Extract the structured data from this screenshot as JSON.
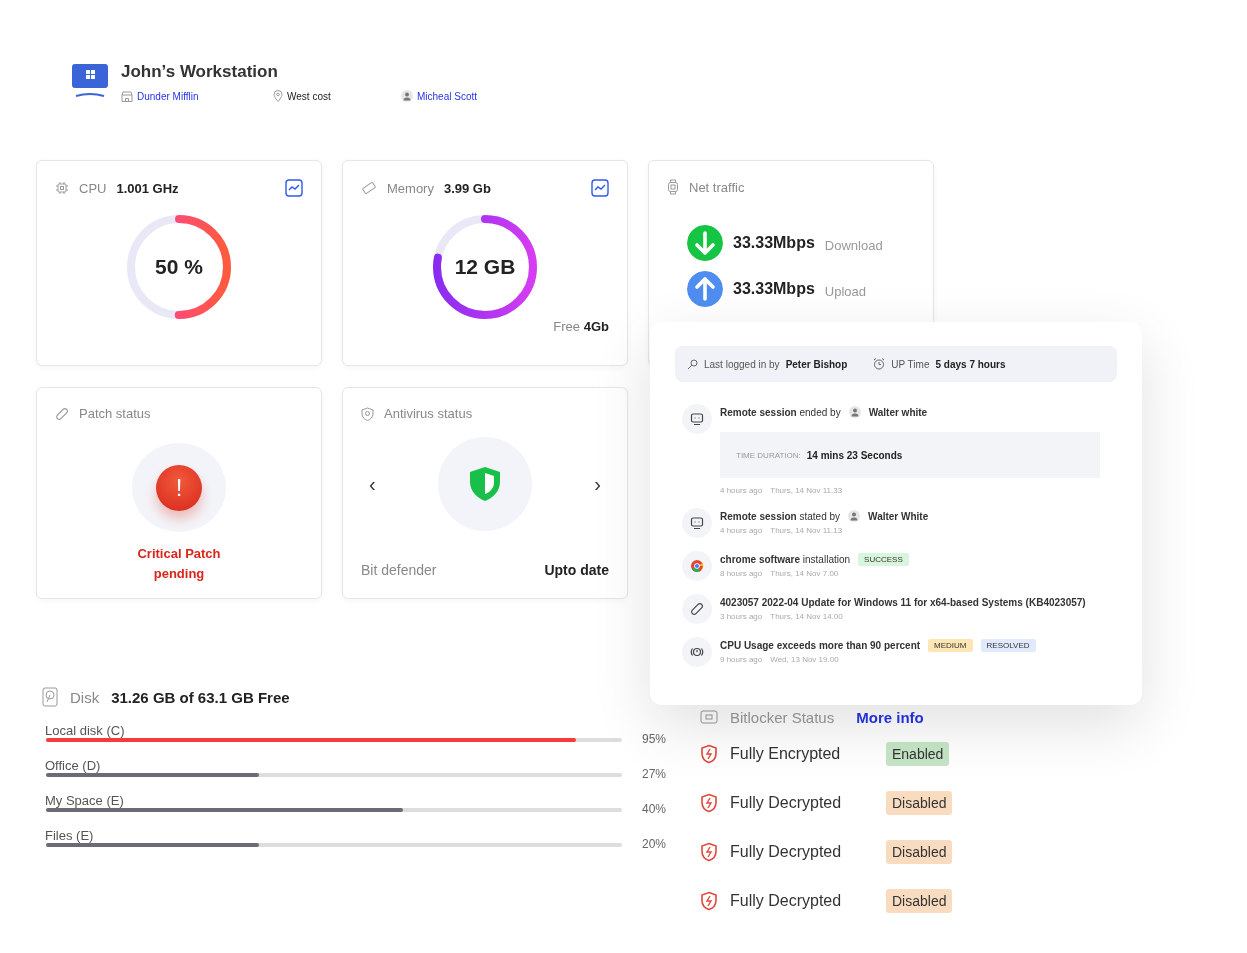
{
  "header": {
    "title": "John’s Workstation",
    "company": "Dunder Mifflin",
    "location": "West cost",
    "user": "Micheal Scott"
  },
  "cpu": {
    "label": "CPU",
    "value": "1.001 GHz",
    "center": "50 %",
    "level": 0.5
  },
  "memory": {
    "label": "Memory",
    "value": "3.99 Gb",
    "center": "12 GB",
    "level": 0.78,
    "free_label": "Free",
    "free_value": "4Gb"
  },
  "net_traffic": {
    "label": "Net traffic",
    "rows": [
      {
        "kind": "download",
        "value": "33.33Mbps",
        "label": "Download"
      },
      {
        "kind": "upload",
        "value": "33.33Mbps",
        "label": "Upload"
      }
    ]
  },
  "patch": {
    "label": "Patch status",
    "icon_text": "!",
    "status": "Critical Patch pending"
  },
  "antivirus": {
    "label": "Antivirus status",
    "prev": "‹",
    "next": "›",
    "name": "Bit defender",
    "status": "Upto date"
  },
  "activity": {
    "login_label": "Last logged in by",
    "login_user": "Peter Bishop",
    "uptime_label": "UP Time",
    "uptime_value": "5 days 7 hours",
    "items": [
      {
        "kind": "session",
        "text": "**Remote session** ended by",
        "person": "Walter white",
        "duration_label": "TIME DURATION:",
        "duration_value": "14 mins 23 Seconds",
        "ago": "4 hours ago",
        "time": "Thurs, 14 Nov 11.33"
      },
      {
        "kind": "session",
        "text": "**Remote session** stated by",
        "person": "Walter White",
        "ago": "4 hours ago",
        "time": "Thurs, 14 Nov 11.13"
      },
      {
        "kind": "chrome",
        "text": "**chrome software** installation",
        "badges": [
          {
            "text": "SUCCESS",
            "color": "#d9f5dc"
          }
        ],
        "ago": "8 hours ago",
        "time": "Thurs, 14 Nov 7.00"
      },
      {
        "kind": "patch",
        "text": "**4023057 2022-04 Update for Windows 11 for x64-based Systems (KB4023057)**",
        "ago": "3 hours ago",
        "time": "Thurs, 14 Nov 14.00"
      },
      {
        "kind": "alert",
        "text": "**CPU Usage exceeds more than 90 percent**",
        "badges": [
          {
            "text": "MEDIUM",
            "color": "#fbe6b4"
          },
          {
            "text": "RESOLVED",
            "color": "#e0eafc"
          }
        ],
        "ago": "9 hours ago",
        "time": "Wed, 13 Nov 19.00"
      }
    ]
  },
  "disk": {
    "label": "Disk",
    "summary": "31.26 GB of 63.1 GB Free",
    "drives": [
      {
        "name": "Local disk (C)",
        "percent": "95%",
        "level": 0.92,
        "color": "#f93a3a"
      },
      {
        "name": "Office (D)",
        "percent": "27%",
        "level": 0.37,
        "color": "#6b6b78"
      },
      {
        "name": "My Space (E)",
        "percent": "40%",
        "level": 0.62,
        "color": "#6b6b78"
      },
      {
        "name": "Files (E)",
        "percent": "20%",
        "level": 0.37,
        "color": "#6b6b78"
      }
    ]
  },
  "bitlocker": {
    "label": "Bitlocker Status",
    "link": "More info",
    "rows": [
      {
        "status": "Fully Encrypted",
        "tag": "Enabled",
        "color": "#c6e5c6"
      },
      {
        "status": "Fully Decrypted",
        "tag": "Disabled",
        "color": "#f9dcc0"
      },
      {
        "status": "Fully Decrypted",
        "tag": "Disabled",
        "color": "#f9dcc0"
      },
      {
        "status": "Fully Decrypted",
        "tag": "Disabled",
        "color": "#f9dcc0"
      }
    ]
  }
}
